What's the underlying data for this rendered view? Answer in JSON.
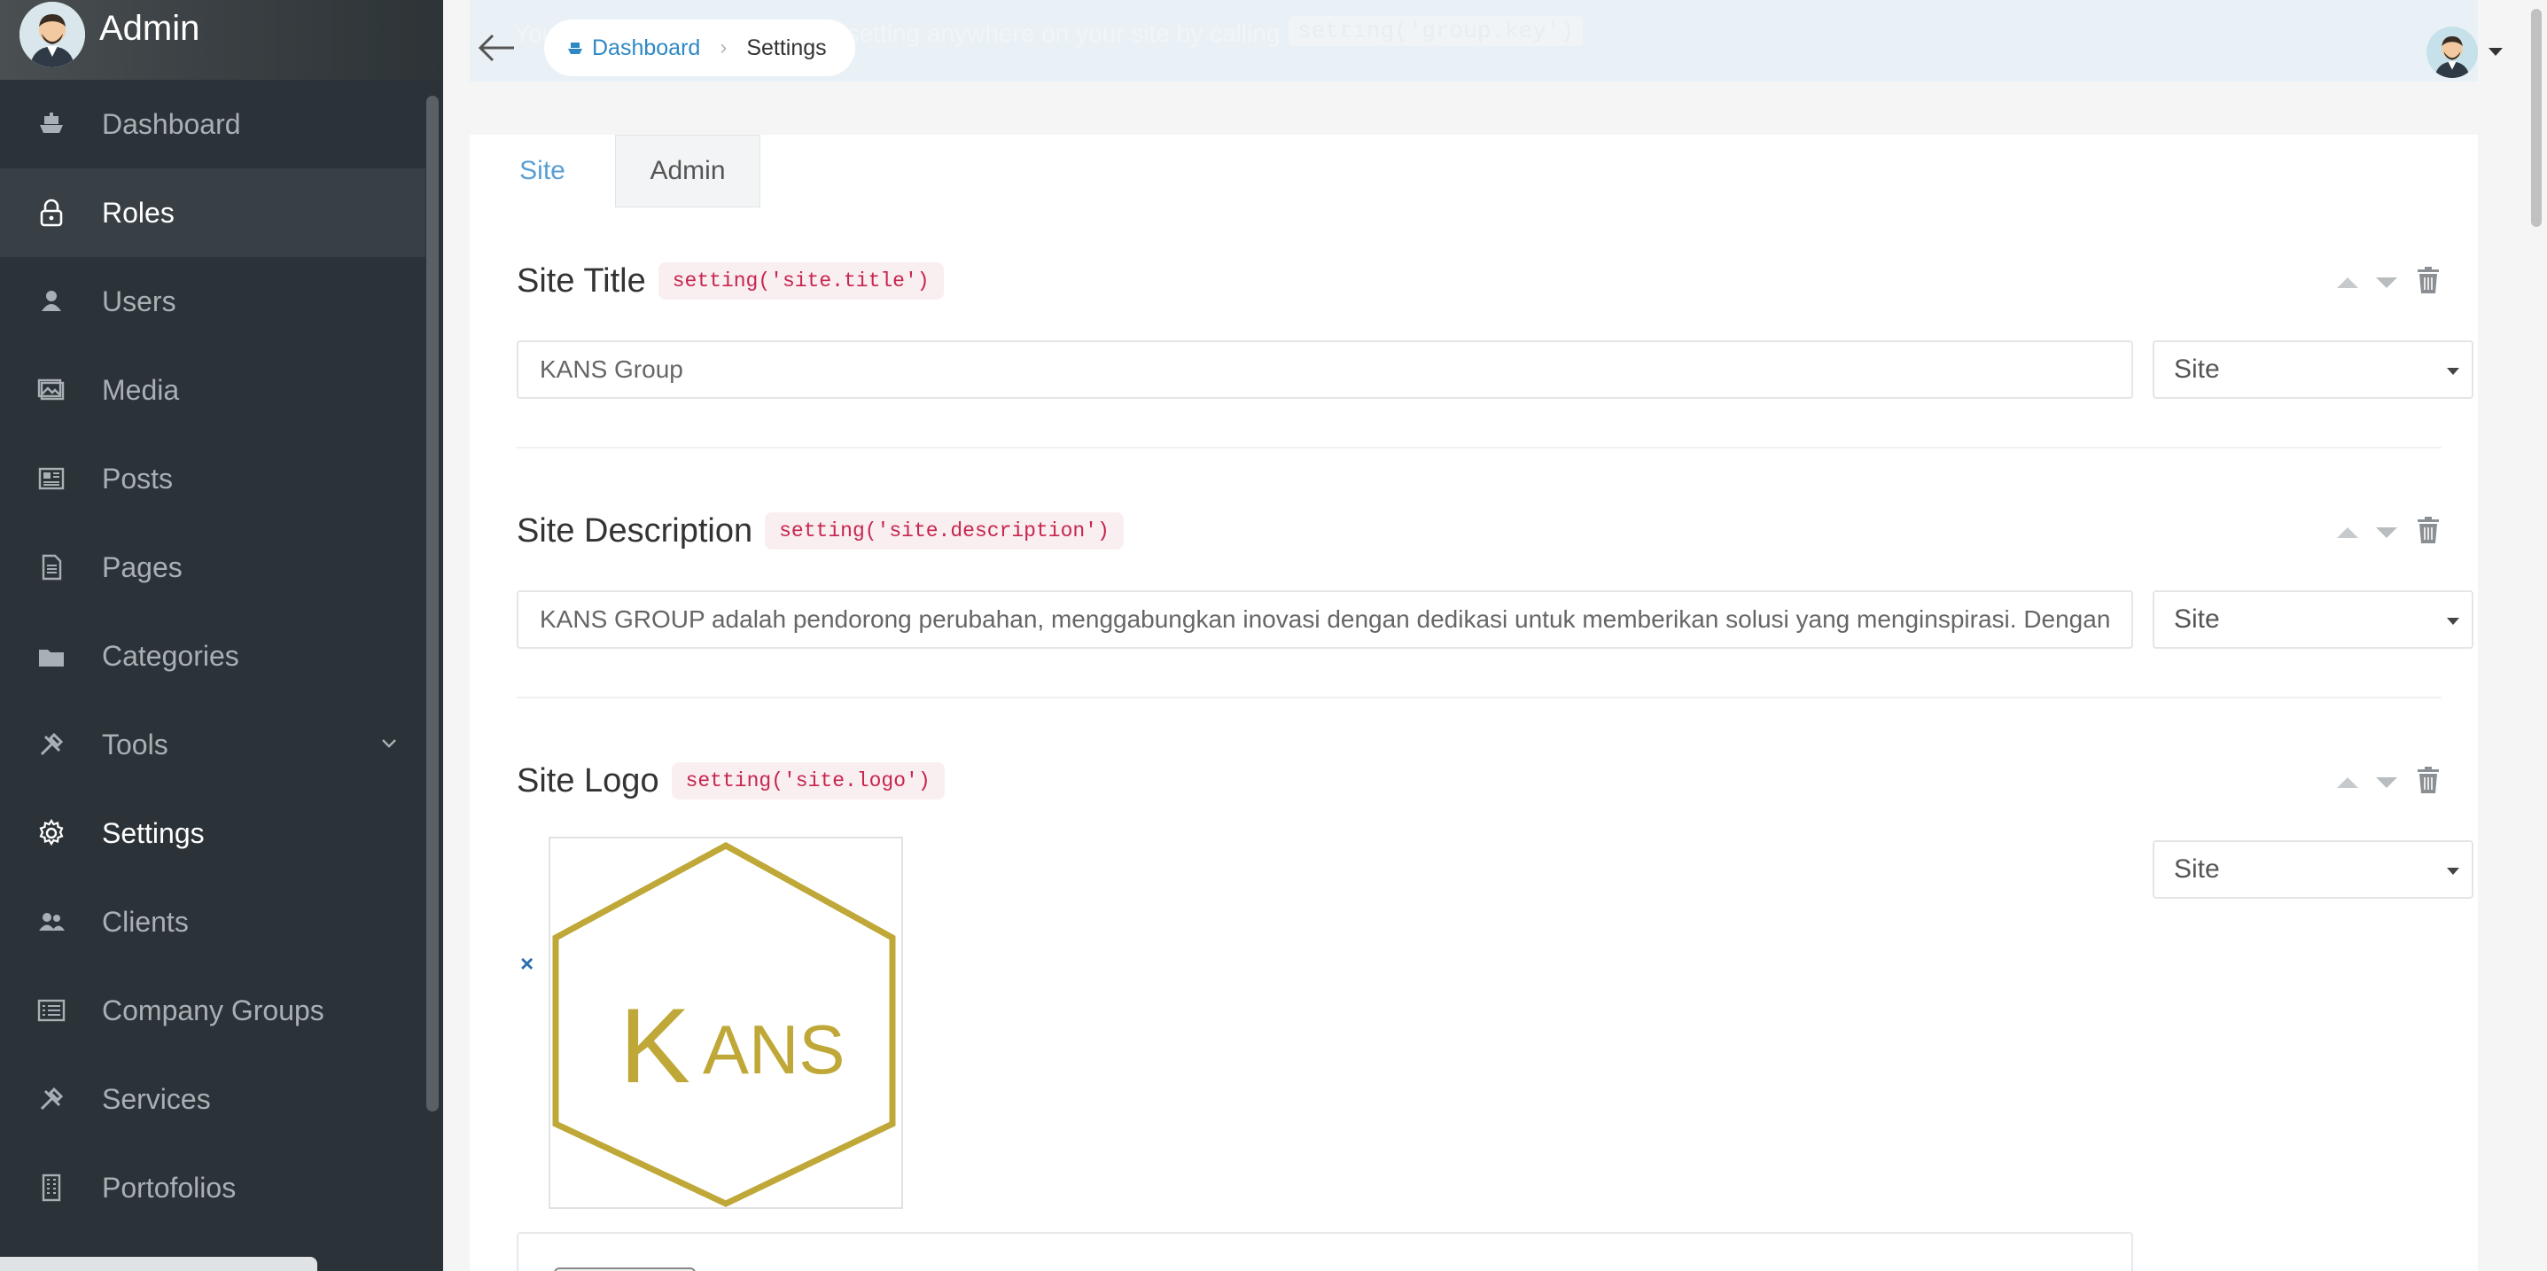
{
  "sidebar": {
    "brand": "Admin",
    "items": [
      {
        "label": "Dashboard",
        "icon": "boat-icon"
      },
      {
        "label": "Roles",
        "icon": "lock-icon"
      },
      {
        "label": "Users",
        "icon": "person-icon"
      },
      {
        "label": "Media",
        "icon": "images-icon"
      },
      {
        "label": "Posts",
        "icon": "news-icon"
      },
      {
        "label": "Pages",
        "icon": "file-text-icon"
      },
      {
        "label": "Categories",
        "icon": "folder-icon"
      },
      {
        "label": "Tools",
        "icon": "tools-icon"
      },
      {
        "label": "Settings",
        "icon": "gear-icon"
      },
      {
        "label": "Clients",
        "icon": "people-icon"
      },
      {
        "label": "Company Groups",
        "icon": "list-icon"
      },
      {
        "label": "Services",
        "icon": "tools-icon"
      },
      {
        "label": "Portofolios",
        "icon": "building-icon"
      }
    ]
  },
  "topbar": {
    "banner_text": "You can get the value of each setting anywhere on your site by calling",
    "banner_code": "setting('group.key')",
    "breadcrumb": {
      "home": "Dashboard",
      "current": "Settings"
    }
  },
  "tabs": [
    "Site",
    "Admin"
  ],
  "settings": [
    {
      "title": "Site Title",
      "key": "setting('site.title')",
      "value": "KANS Group",
      "group": "Site"
    },
    {
      "title": "Site Description",
      "key": "setting('site.description')",
      "value": "KANS GROUP adalah pendorong perubahan, menggabungkan inovasi dengan dedikasi untuk memberikan solusi yang menginspirasi. Dengan",
      "group": "Site"
    },
    {
      "title": "Site Logo",
      "key": "setting('site.logo')",
      "group": "Site",
      "remove_label": "×"
    }
  ],
  "logo": {
    "text_k": "K",
    "text_ans": "ANS",
    "color": "#bfa838"
  },
  "colors": {
    "sidebar": "#2c3338",
    "accent": "#2d88c4",
    "code": "#c7254e"
  }
}
